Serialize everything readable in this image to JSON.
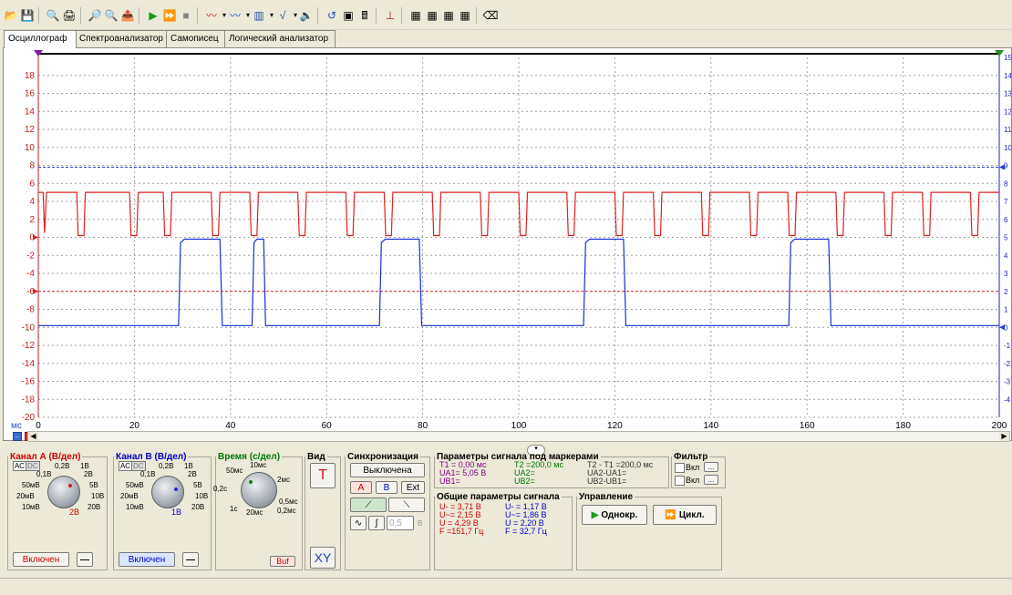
{
  "tabs": [
    "Осциллограф",
    "Спектроанализатор",
    "Самописец",
    "Логический анализатор"
  ],
  "toolbar_icons": [
    "open-folder-icon",
    "save-icon",
    "print-preview-icon",
    "print-icon",
    "zoom-in-icon",
    "zoom-out-icon",
    "export-icon",
    "run-icon",
    "fast-run-icon",
    "stop-icon",
    "signal-icon",
    "signal2-icon",
    "memory-icon",
    "formula-icon",
    "speaker-icon",
    "refresh-icon",
    "device-icon",
    "calculator-icon",
    "probe-icon",
    "chip1-icon",
    "chip2-icon",
    "chip3-icon",
    "chip4-icon",
    "eraser-icon"
  ],
  "chart_data": {
    "type": "line",
    "xlabel": "мс",
    "xlim": [
      0,
      200
    ],
    "ylim": [
      -20,
      20
    ],
    "right_ylim": [
      -5,
      15
    ],
    "x_ticks": [
      0,
      20,
      40,
      60,
      80,
      100,
      120,
      140,
      160,
      180,
      200
    ],
    "y_ticks": [
      18,
      16,
      14,
      12,
      10,
      8,
      6,
      4,
      2,
      0,
      -2,
      -4,
      -6,
      -8,
      -10,
      -12,
      -14,
      -16,
      -18,
      -20
    ],
    "right_ticks": [
      15,
      14,
      13,
      12,
      11,
      10,
      9,
      8,
      7,
      6,
      5,
      4,
      3,
      2,
      1,
      0,
      -1,
      -2,
      -3,
      -4
    ],
    "grid": true,
    "markers": {
      "upper_level": 7.8,
      "lower_level": -6
    },
    "series": [
      {
        "color": "#e02020",
        "segments": [
          [
            0,
            5
          ],
          [
            1,
            5
          ],
          [
            1.3,
            0.5
          ],
          [
            1.7,
            5
          ],
          [
            8,
            5
          ],
          [
            8.3,
            0.2
          ],
          [
            9.5,
            0.2
          ],
          [
            9.8,
            5
          ],
          [
            19,
            5
          ],
          [
            19.3,
            0.2
          ],
          [
            20.5,
            0.2
          ],
          [
            20.8,
            5
          ],
          [
            26,
            5
          ],
          [
            26.3,
            0.2
          ],
          [
            27.5,
            0.2
          ],
          [
            27.8,
            5
          ],
          [
            36,
            5
          ],
          [
            36.3,
            0.2
          ],
          [
            37.5,
            0.2
          ],
          [
            37.8,
            5
          ],
          [
            44,
            5
          ],
          [
            44.3,
            0.2
          ],
          [
            45.5,
            0.2
          ],
          [
            45.8,
            5
          ],
          [
            54,
            5
          ],
          [
            54.3,
            0.2
          ],
          [
            55.5,
            0.2
          ],
          [
            55.8,
            5
          ],
          [
            64,
            5
          ],
          [
            64.3,
            0.2
          ],
          [
            65.5,
            0.2
          ],
          [
            65.8,
            5
          ],
          [
            72,
            5
          ],
          [
            72.3,
            0.2
          ],
          [
            73.5,
            0.2
          ],
          [
            73.8,
            5
          ],
          [
            82,
            5
          ],
          [
            82.3,
            0.2
          ],
          [
            83.5,
            0.2
          ],
          [
            83.8,
            5
          ],
          [
            92,
            5
          ],
          [
            92.3,
            0.2
          ],
          [
            93.5,
            0.2
          ],
          [
            93.8,
            5
          ],
          [
            100,
            5
          ],
          [
            100.3,
            0.2
          ],
          [
            101.5,
            0.2
          ],
          [
            101.8,
            5
          ],
          [
            110,
            5
          ],
          [
            110.3,
            0.2
          ],
          [
            111.5,
            0.2
          ],
          [
            111.8,
            5
          ],
          [
            120,
            5
          ],
          [
            120.3,
            0.2
          ],
          [
            121.5,
            0.2
          ],
          [
            121.8,
            5
          ],
          [
            128,
            5
          ],
          [
            128.3,
            0.2
          ],
          [
            129.5,
            0.2
          ],
          [
            129.8,
            5
          ],
          [
            138,
            5
          ],
          [
            138.3,
            0.2
          ],
          [
            139.5,
            0.2
          ],
          [
            139.8,
            5
          ],
          [
            148,
            5
          ],
          [
            148.3,
            0.2
          ],
          [
            149.5,
            0.2
          ],
          [
            149.8,
            5
          ],
          [
            156,
            5
          ],
          [
            156.3,
            0.2
          ],
          [
            157.5,
            0.2
          ],
          [
            157.8,
            5
          ],
          [
            166,
            5
          ],
          [
            166.3,
            0.2
          ],
          [
            167.5,
            0.2
          ],
          [
            167.8,
            5
          ],
          [
            176,
            5
          ],
          [
            176.3,
            0.2
          ],
          [
            177.5,
            0.2
          ],
          [
            177.8,
            5
          ],
          [
            184,
            5
          ],
          [
            184.3,
            0.2
          ],
          [
            185.5,
            0.2
          ],
          [
            185.8,
            5
          ],
          [
            194,
            5
          ],
          [
            194.3,
            0.2
          ],
          [
            195.5,
            0.2
          ],
          [
            195.8,
            5
          ],
          [
            200,
            5
          ]
        ]
      },
      {
        "color": "#1530d8",
        "segments": [
          [
            0,
            -9.8
          ],
          [
            29.2,
            -9.8
          ],
          [
            29.6,
            -0.6
          ],
          [
            30.4,
            -0.2
          ],
          [
            37.8,
            -0.2
          ],
          [
            38.3,
            -9.8
          ],
          [
            44.5,
            -9.8
          ],
          [
            44.9,
            -0.6
          ],
          [
            45.5,
            -0.2
          ],
          [
            46.9,
            -0.2
          ],
          [
            47.3,
            -9.8
          ],
          [
            71,
            -9.8
          ],
          [
            71.4,
            -0.6
          ],
          [
            72.2,
            -0.2
          ],
          [
            79.3,
            -0.2
          ],
          [
            79.8,
            -9.8
          ],
          [
            113.5,
            -9.8
          ],
          [
            113.9,
            -0.6
          ],
          [
            114.7,
            -0.2
          ],
          [
            121.8,
            -0.2
          ],
          [
            122.3,
            -9.8
          ],
          [
            156.2,
            -9.8
          ],
          [
            156.6,
            -0.6
          ],
          [
            157.4,
            -0.2
          ],
          [
            164.5,
            -0.2
          ],
          [
            165,
            -9.8
          ],
          [
            200,
            -9.8
          ]
        ]
      }
    ]
  },
  "channel_a": {
    "title": "Канал А (В/дел)",
    "labels": [
      "0,1В",
      "0,2В",
      "1В",
      "2В",
      "50мВ",
      "5В",
      "20мВ",
      "10В",
      "10мВ",
      "20В"
    ],
    "value": "2В",
    "state": "Включен",
    "coupling_ac": "АС",
    "coupling_dc": "DC"
  },
  "channel_b": {
    "title": "Канал В (В/дел)",
    "labels": [
      "0,1В",
      "0,2В",
      "1В",
      "2В",
      "50мВ",
      "5В",
      "20мВ",
      "10В",
      "10мВ",
      "20В"
    ],
    "value": "1В",
    "state": "Включен",
    "coupling_ac": "АС",
    "coupling_dc": "DC"
  },
  "time": {
    "title": "Время (с/дел)",
    "labels": [
      "10мс",
      "50мс",
      "2мс",
      "0,2с",
      "0,5мс",
      "1с",
      "0,2мс",
      "20мс"
    ],
    "buf": "Buf"
  },
  "view": {
    "title": "Вид",
    "t": "T",
    "xy": "XY"
  },
  "sync": {
    "title": "Синхронизация",
    "state": "Выключена",
    "a": "A",
    "b": "B",
    "ext": "Ext",
    "level": "0,5",
    "level_unit": "В"
  },
  "marker_params": {
    "title": "Параметры сигнала под маркерами",
    "t1": "T1 = 0,00 мс",
    "ua1": "UA1= 5,05 В",
    "ub1": "UB1=",
    "t2": "T2 =200,0 мс",
    "ua2": "UA2=",
    "ub2": "UB2=",
    "dt": "T2 - T1 =200,0 мс",
    "dua": "UA2-UA1=",
    "dub": "UB2-UB1="
  },
  "general_params": {
    "title": "Общие параметры сигнала",
    "a_udc": "U- = 3,71 В",
    "a_uac": "U~= 2,15 В",
    "a_u": "U = 4,29 В",
    "a_f": "F =151,7 Гц",
    "b_udc": "U- = 1,17 В",
    "b_uac": "U~= 1,86 В",
    "b_u": "U = 2,20 В",
    "b_f": "F = 32,7 Гц"
  },
  "filter": {
    "title": "Фильтр",
    "on1": "Вкл",
    "on2": "Вкл",
    "dots": "..."
  },
  "control": {
    "title": "Управление",
    "single": "Однокр.",
    "cycle": "Цикл."
  },
  "colors": {
    "channel_a": "#cc0000",
    "channel_b": "#0000cc",
    "time": "#007700",
    "grid": "#9a9a9a"
  }
}
